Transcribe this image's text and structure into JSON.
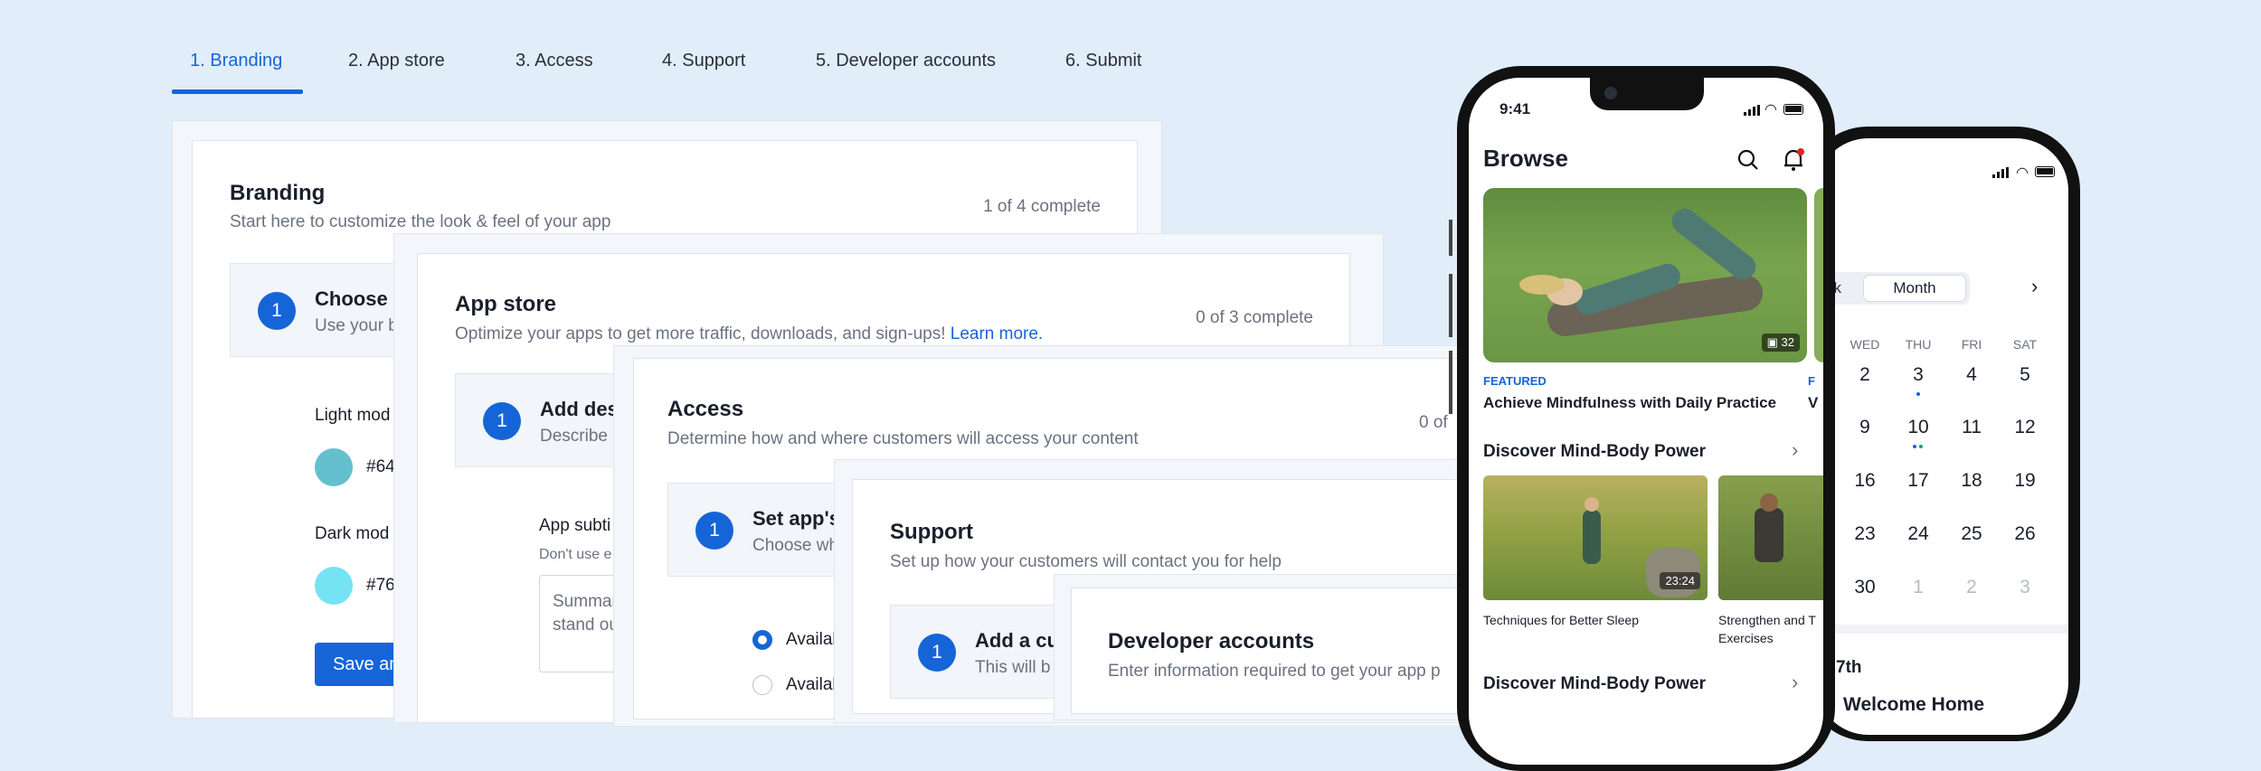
{
  "tabs": [
    "1. Branding",
    "2. App store",
    "3. Access",
    "4. Support",
    "5. Developer accounts",
    "6. Submit"
  ],
  "colors": {
    "accent": "#1565d8",
    "background": "#e1edf9",
    "light_mode_swatch": "#64bfcf",
    "dark_mode_swatch": "#76e3f5"
  },
  "branding": {
    "title": "Branding",
    "subtitle": "Start here to customize the look & feel of your app",
    "count": "1 of 4 complete",
    "step_num": "1",
    "step_title": "Choose a",
    "step_sub": "Use your b",
    "light_label": "Light mod",
    "light_hex": "#64",
    "dark_label": "Dark mod",
    "dark_hex": "#76",
    "save_btn": "Save an"
  },
  "app_store": {
    "title": "App store",
    "subtitle": "Optimize your apps to get more traffic, downloads, and sign-ups!",
    "learn_more": "Learn more.",
    "count": "0 of 3 complete",
    "step_num": "1",
    "step_title": "Add des",
    "step_sub": "Describe",
    "field_label": "App subti",
    "field_hint": "Don't use e",
    "textarea_l1": "Summar",
    "textarea_l2": "stand ou"
  },
  "access": {
    "title": "Access",
    "subtitle": "Determine how and where customers will access your content",
    "count": "0 of",
    "step_num": "1",
    "step_title": "Set app's",
    "step_sub": "Choose wh",
    "option1": "Availab",
    "option2": "Availab"
  },
  "support": {
    "title": "Support",
    "subtitle": "Set up how your customers will contact you for help",
    "step_num": "1",
    "step_title": "Add a cu",
    "step_sub": "This will b"
  },
  "developer_accounts": {
    "title": "Developer accounts",
    "subtitle": "Enter information required to get your app p"
  },
  "phone1": {
    "time": "9:41",
    "title": "Browse",
    "hero_count": "32",
    "featured_label": "FEATURED",
    "featured_title": "Achieve Mindfulness with Daily Practice",
    "section1": "Discover Mind-Body Power",
    "card1_duration": "23:24",
    "card1_title": "Techniques for Better Sleep",
    "card2_title_l1": "Strengthen and T",
    "card2_title_l2": "Exercises",
    "section2": "Discover Mind-Body Power",
    "peek_label": "F",
    "peek_title": "V"
  },
  "phone2": {
    "seg_left": "ek",
    "seg_active": "Month",
    "weekdays": [
      "WED",
      "THU",
      "FRI",
      "SAT"
    ],
    "rows": [
      [
        "2",
        "3",
        "4",
        "5"
      ],
      [
        "9",
        "10",
        "11",
        "12"
      ],
      [
        "16",
        "17",
        "18",
        "19"
      ],
      [
        "23",
        "24",
        "25",
        "26"
      ],
      [
        "30",
        "1",
        "2",
        "3"
      ]
    ],
    "date_label": "7th",
    "event_title": "Welcome Home"
  }
}
